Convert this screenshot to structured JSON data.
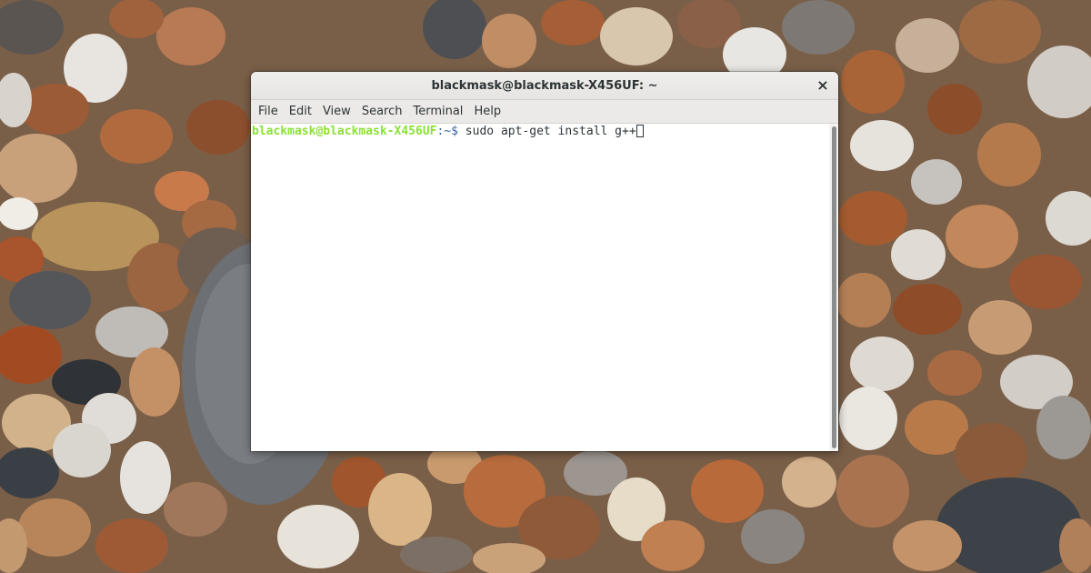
{
  "window": {
    "title": "blackmask@blackmask-X456UF: ~",
    "close_icon": "×"
  },
  "menubar": {
    "items": [
      {
        "label": "File"
      },
      {
        "label": "Edit"
      },
      {
        "label": "View"
      },
      {
        "label": "Search"
      },
      {
        "label": "Terminal"
      },
      {
        "label": "Help"
      }
    ]
  },
  "terminal": {
    "prompt_user": "blackmask@blackmask-X456UF",
    "prompt_path": ":~$",
    "command": " sudo apt-get install g++"
  },
  "colors": {
    "prompt_user": "#8ae234",
    "text": "#2e3436"
  }
}
